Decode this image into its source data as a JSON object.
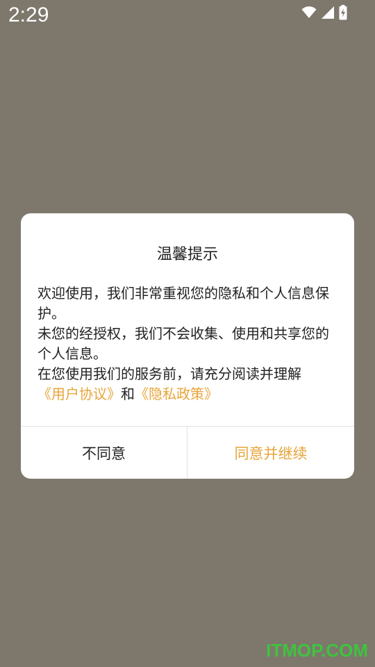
{
  "status_bar": {
    "time": "2:29",
    "icons": [
      "wifi-icon",
      "cellular-signal-icon",
      "battery-charging-icon"
    ]
  },
  "dialog": {
    "title": "温馨提示",
    "body": {
      "line1": "欢迎使用，我们非常重视您的隐私和个人信息保护。",
      "line2": "未您的经授权，我们不会收集、使用和共享您的个人信息。",
      "line3": "在您使用我们的服务前，请充分阅读并理解",
      "link_user_agreement": "《用户协议》",
      "and_text": "和",
      "link_privacy_policy": "《隐私政策》"
    },
    "buttons": {
      "disagree": "不同意",
      "agree": "同意并继续"
    }
  },
  "colors": {
    "background_overlay": "#7e776c",
    "accent": "#e8a43a",
    "watermark": "#3fc33f"
  },
  "watermark": "ITMOP.COM"
}
